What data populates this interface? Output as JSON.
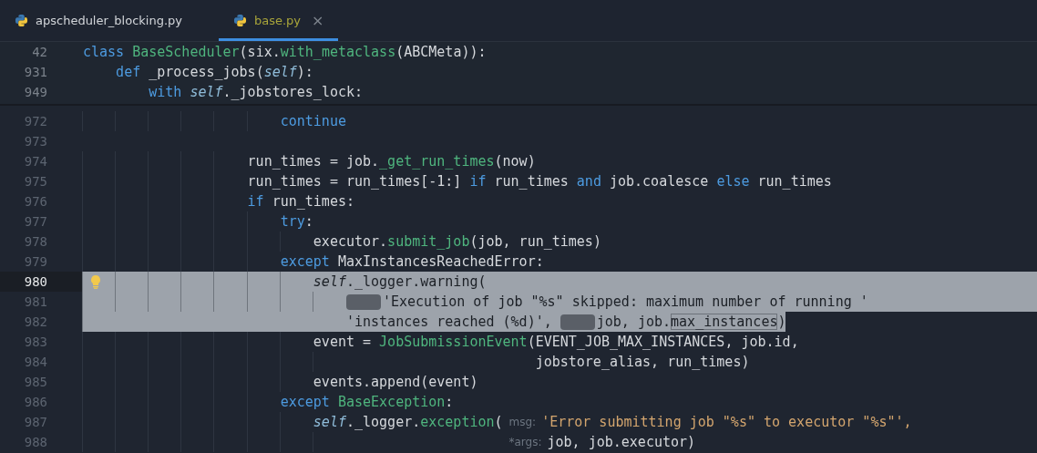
{
  "tabs": [
    {
      "label": "apscheduler_blocking.py",
      "selected": false
    },
    {
      "label": "base.py",
      "selected": true,
      "close": "×"
    }
  ],
  "sticky_lines": [
    {
      "number": "42",
      "tokens": [
        {
          "kind": "kw",
          "text": "class "
        },
        {
          "kind": "fn",
          "text": "BaseScheduler"
        },
        {
          "kind": "plain",
          "text": "(six."
        },
        {
          "kind": "fn",
          "text": "with_metaclass"
        },
        {
          "kind": "plain",
          "text": "(ABCMeta)):"
        }
      ]
    },
    {
      "number": "931",
      "tokens": [
        {
          "kind": "kw",
          "text": "    def "
        },
        {
          "kind": "plain",
          "text": "_process_jobs("
        },
        {
          "kind": "self",
          "text": "self"
        },
        {
          "kind": "plain",
          "text": "):"
        }
      ]
    },
    {
      "number": "949",
      "tokens": [
        {
          "kind": "kw",
          "text": "        with "
        },
        {
          "kind": "self",
          "text": "self"
        },
        {
          "kind": "plain",
          "text": "._jobstores_lock:"
        }
      ]
    }
  ],
  "lines": [
    {
      "number": "972",
      "selected": false,
      "tokens": [
        {
          "kind": "kw",
          "text": "                        continue"
        }
      ]
    },
    {
      "number": "973",
      "selected": false
    },
    {
      "number": "974",
      "selected": false,
      "tokens": [
        {
          "kind": "plain",
          "text": "                    run_times = job."
        },
        {
          "kind": "fn",
          "text": "_get_run_times"
        },
        {
          "kind": "plain",
          "text": "(now)"
        }
      ]
    },
    {
      "number": "975",
      "selected": false,
      "tokens": [
        {
          "kind": "plain",
          "text": "                    run_times = run_times[-1:] "
        },
        {
          "kind": "kw",
          "text": "if"
        },
        {
          "kind": "plain",
          "text": " run_times "
        },
        {
          "kind": "kw",
          "text": "and"
        },
        {
          "kind": "plain",
          "text": " job.coalesce "
        },
        {
          "kind": "kw",
          "text": "else"
        },
        {
          "kind": "plain",
          "text": " run_times"
        }
      ]
    },
    {
      "number": "976",
      "selected": false,
      "tokens": [
        {
          "kind": "kw",
          "text": "                    if"
        },
        {
          "kind": "plain",
          "text": " run_times:"
        }
      ]
    },
    {
      "number": "977",
      "selected": false,
      "tokens": [
        {
          "kind": "kw",
          "text": "                        try"
        },
        {
          "kind": "plain",
          "text": ":"
        }
      ]
    },
    {
      "number": "978",
      "selected": false,
      "tokens": [
        {
          "kind": "plain",
          "text": "                            executor."
        },
        {
          "kind": "fn",
          "text": "submit_job"
        },
        {
          "kind": "plain",
          "text": "(job, run_times)"
        }
      ]
    },
    {
      "number": "979",
      "selected": false,
      "tokens": [
        {
          "kind": "kw",
          "text": "                        except"
        },
        {
          "kind": "plain",
          "text": " MaxInstancesReachedError:"
        }
      ]
    },
    {
      "number": "980",
      "selected": true,
      "current": true,
      "bulb": true,
      "tokens": [
        {
          "kind": "self",
          "text": "                            self"
        },
        {
          "kind": "plain",
          "text": "._logger.warning("
        }
      ]
    },
    {
      "number": "981",
      "selected": true,
      "tokens": [
        {
          "kind": "redacted"
        },
        {
          "kind": "str",
          "text": "'Execution of job \"%s\" skipped: maximum number of running '"
        }
      ]
    },
    {
      "number": "982",
      "selected": true,
      "selection_to_text_end": true,
      "tokens": [
        {
          "kind": "str",
          "text": "                                'instances reached (%d)'"
        },
        {
          "kind": "plain",
          "text": ", "
        },
        {
          "kind": "redacted"
        },
        {
          "kind": "plain",
          "text": "job, job."
        },
        {
          "kind": "boxed",
          "text": "max_instances"
        },
        {
          "kind": "plain",
          "text": ")"
        }
      ]
    },
    {
      "number": "983",
      "selected": false,
      "tokens": [
        {
          "kind": "plain",
          "text": "                            event = "
        },
        {
          "kind": "fn",
          "text": "JobSubmissionEvent"
        },
        {
          "kind": "plain",
          "text": "(EVENT_JOB_MAX_INSTANCES, job.id,"
        }
      ]
    },
    {
      "number": "984",
      "selected": false,
      "tokens": [
        {
          "kind": "plain",
          "text": "                                                       jobstore_alias, run_times)"
        }
      ]
    },
    {
      "number": "985",
      "selected": false,
      "tokens": [
        {
          "kind": "plain",
          "text": "                            events.append(event)"
        }
      ]
    },
    {
      "number": "986",
      "selected": false,
      "tokens": [
        {
          "kind": "kw",
          "text": "                        except "
        },
        {
          "kind": "fn",
          "text": "BaseException"
        },
        {
          "kind": "plain",
          "text": ":"
        }
      ]
    },
    {
      "number": "987",
      "selected": false,
      "tokens": [
        {
          "kind": "self",
          "text": "                            self"
        },
        {
          "kind": "plain",
          "text": "._logger."
        },
        {
          "kind": "fn",
          "text": "exception"
        },
        {
          "kind": "plain",
          "text": "("
        },
        {
          "kind": "hint",
          "text": "msg:"
        },
        {
          "kind": "str",
          "text": "'Error submitting job \"%s\" to executor \"%s\"',"
        }
      ]
    },
    {
      "number": "988",
      "selected": false,
      "tokens": [
        {
          "kind": "hint",
          "text": "*args:"
        },
        {
          "kind": "plain",
          "text": "job, job.executor)"
        }
      ]
    }
  ]
}
